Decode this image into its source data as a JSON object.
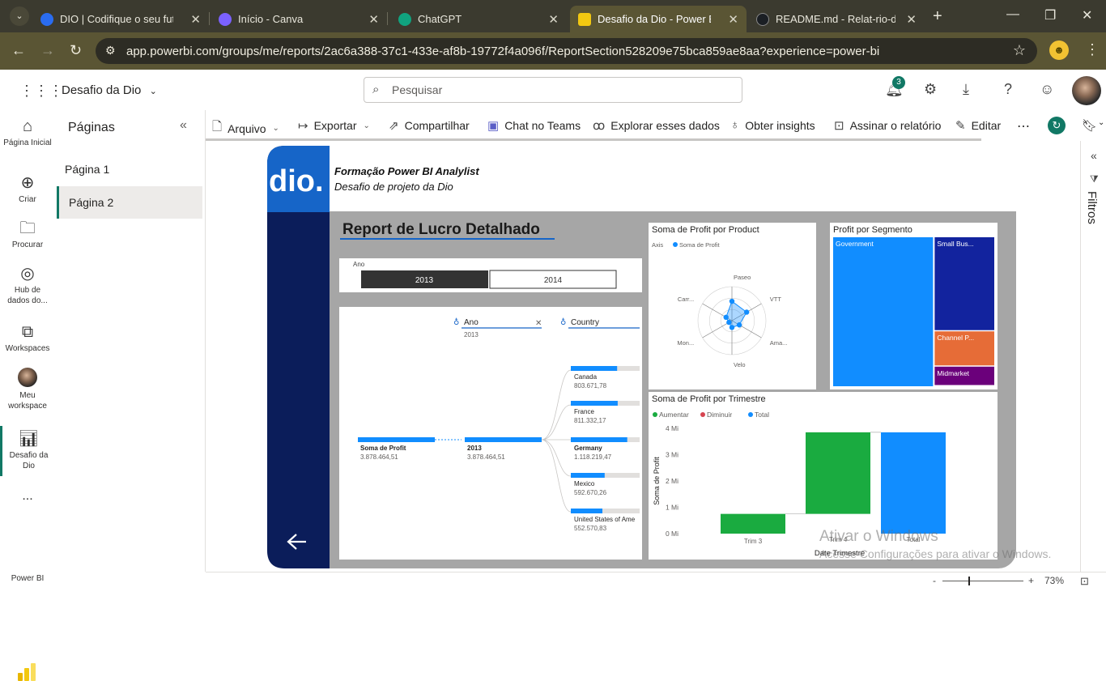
{
  "browser": {
    "tabs": [
      {
        "title": "DIO | Codifique o seu futuro",
        "color": "#2a6cf0"
      },
      {
        "title": "Início - Canva",
        "color": "#7b61ff"
      },
      {
        "title": "ChatGPT",
        "color": "#10a37f"
      },
      {
        "title": "Desafio da Dio - Power BI",
        "color": "#f2c811"
      },
      {
        "title": "README.md - Relat-rio-de-V",
        "color": "#1b1f24"
      }
    ],
    "url": "app.powerbi.com/groups/me/reports/2ac6a388-37c1-433e-af8b-19772f4a096f/ReportSection528209e75bca859ae8aa?experience=power-bi"
  },
  "header": {
    "workspace": "Desafio da Dio",
    "search_placeholder": "Pesquisar",
    "notif_count": "3"
  },
  "leftnav": [
    {
      "label": "Página Inicial",
      "icon": "home-icon"
    },
    {
      "label": "Criar",
      "icon": "plus-circle-icon"
    },
    {
      "label": "Procurar",
      "icon": "folder-icon"
    },
    {
      "label": "Hub de dados do...",
      "icon": "data-hub-icon"
    },
    {
      "label": "Workspaces",
      "icon": "workspaces-icon"
    },
    {
      "label": "Meu workspace",
      "icon": "avatar"
    },
    {
      "label": "Desafio da Dio",
      "icon": "report-icon"
    },
    {
      "label": "...",
      "icon": "more-icon"
    },
    {
      "label": "Power BI",
      "icon": "powerbi-logo"
    }
  ],
  "pages_pane": {
    "title": "Páginas",
    "pages": [
      "Página 1",
      "Página 2"
    ],
    "selected": 1
  },
  "toolbar": {
    "arquivo": "Arquivo",
    "exportar": "Exportar",
    "compartilhar": "Compartilhar",
    "teams": "Chat no Teams",
    "explorar": "Explorar esses dados",
    "insights": "Obter insights",
    "assinar": "Assinar o relatório",
    "editar": "Editar"
  },
  "filters": {
    "label": "Filtros"
  },
  "status": {
    "zoom": "73%"
  },
  "watermark": {
    "line1": "Ativar o Windows",
    "line2": "Acesse Configurações para ativar o Windows."
  },
  "report": {
    "brand": "dio.",
    "heading_bold": "Formação Power BI Analylist",
    "heading_sub": "Desafio de projeto da Dio",
    "title": "Report de Lucro Detalhado",
    "slicer": {
      "label": "Ano",
      "options": [
        "2013",
        "2014"
      ],
      "selected": 0
    },
    "decomp": {
      "headers": [
        "Ano",
        "Country"
      ],
      "ano_filter": "2013",
      "root": {
        "label": "Soma de Profit",
        "value": "3.878.464,51"
      },
      "level1": {
        "label": "2013",
        "value": "3.878.464,51"
      },
      "countries": [
        {
          "name": "Canada",
          "value": "803.671,78",
          "fill": 0.82
        },
        {
          "name": "France",
          "value": "811.332,17",
          "fill": 0.83
        },
        {
          "name": "Germany",
          "value": "1.118.219,47",
          "fill": 1.0
        },
        {
          "name": "Mexico",
          "value": "592.670,26",
          "fill": 0.6
        },
        {
          "name": "United States of Ame",
          "value": "552.570,83",
          "fill": 0.56
        }
      ]
    },
    "radar": {
      "title": "Soma de Profit por Product",
      "legend_axis": "Axis",
      "legend_series": "Soma de Profit"
    },
    "treemap": {
      "title": "Profit por Segmento"
    },
    "waterfall": {
      "title": "Soma de Profit por Trimestre",
      "legend": [
        "Aumentar",
        "Diminuir",
        "Total"
      ]
    }
  },
  "chart_data": [
    {
      "type": "radar",
      "title": "Soma de Profit por Product",
      "categories": [
        "Paseo",
        "VTT",
        "Ama...",
        "Velo",
        "Mon...",
        "Carr..."
      ],
      "values": [
        0.57,
        0.5,
        0.25,
        0.2,
        0.1,
        0.2
      ],
      "series": [
        {
          "name": "Soma de Profit",
          "color": "#118dff"
        }
      ]
    },
    {
      "type": "treemap",
      "title": "Profit por Segmento",
      "categories": [
        "Government",
        "Small Bus...",
        "Channel P...",
        "Midmarket"
      ],
      "values": [
        0.62,
        0.24,
        0.09,
        0.05
      ],
      "colors": [
        "#118dff",
        "#12239e",
        "#e66c37",
        "#6b007b"
      ]
    },
    {
      "type": "bar",
      "subtype": "waterfall",
      "title": "Soma de Profit por Trimestre",
      "xlabel": "Date Trimestre",
      "ylabel": "Soma de Profit",
      "categories": [
        "Trim 3",
        "Trim 4",
        "Total"
      ],
      "ylim": [
        0,
        4
      ],
      "yticks": [
        "0 Mi",
        "1 Mi",
        "2 Mi",
        "3 Mi",
        "4 Mi"
      ],
      "series": [
        {
          "name": "Aumentar",
          "color": "#1aab40",
          "start": [
            0,
            0.75
          ],
          "end": [
            0.75,
            3.85
          ]
        },
        {
          "name": "Diminuir",
          "color": "#d64550"
        },
        {
          "name": "Total",
          "color": "#118dff",
          "start": [
            0
          ],
          "end": [
            3.85
          ]
        }
      ]
    }
  ]
}
